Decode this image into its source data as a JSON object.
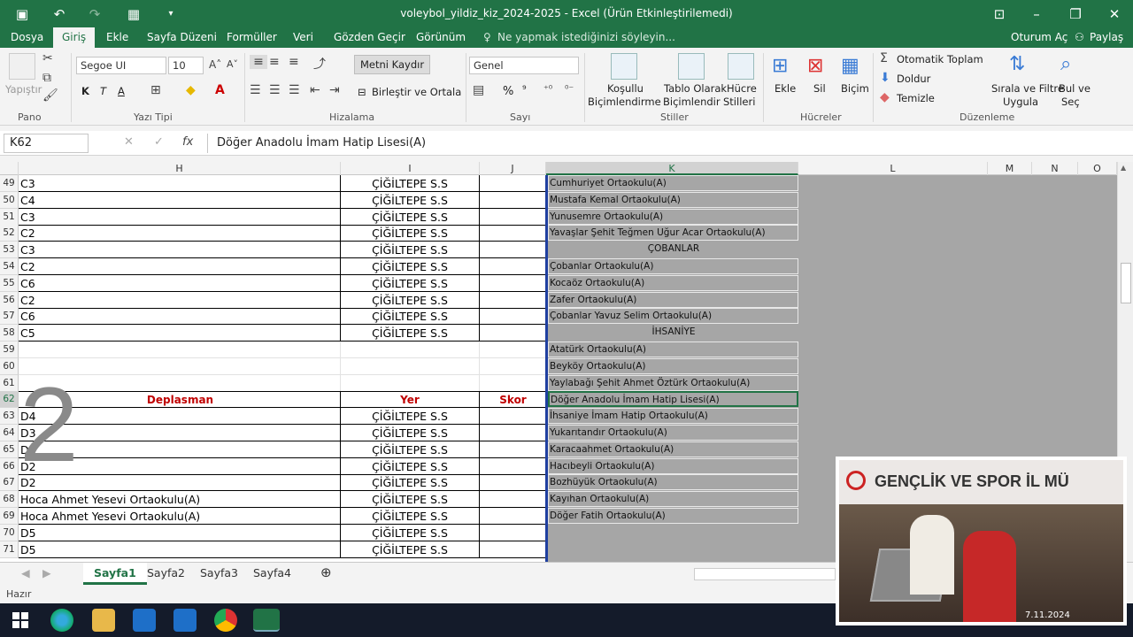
{
  "window": {
    "title": "voleybol_yildiz_kiz_2024-2025 - Excel (Ürün Etkinleştirilemedi)"
  },
  "tabs": [
    "Dosya",
    "Giriş",
    "Ekle",
    "Sayfa Düzeni",
    "Formüller",
    "Veri",
    "Gözden Geçir",
    "Görünüm"
  ],
  "tell_me": "Ne yapmak istediğinizi söyleyin...",
  "account": {
    "signin": "Oturum Aç",
    "share": "Paylaş"
  },
  "ribbon": {
    "clipboard": {
      "paste": "Yapıştır",
      "label": "Pano"
    },
    "font": {
      "name": "Segoe UI",
      "size": "10",
      "bold": "K",
      "italic": "T",
      "underline": "A",
      "label": "Yazı Tipi"
    },
    "alignment": {
      "wrap": "Metni Kaydır",
      "merge": "Birleştir ve Ortala",
      "label": "Hizalama"
    },
    "number": {
      "format": "Genel",
      "percent": "%",
      "comma": "⁹",
      "label": "Sayı"
    },
    "styles": {
      "conditional1": "Koşullu",
      "conditional2": "Biçimlendirme",
      "table1": "Tablo Olarak",
      "table2": "Biçimlendir",
      "cell1": "Hücre",
      "cell2": "Stilleri",
      "label": "Stiller"
    },
    "cells": {
      "insert": "Ekle",
      "delete": "Sil",
      "format": "Biçim",
      "label": "Hücreler"
    },
    "editing": {
      "autosum": "Otomatik Toplam",
      "fill": "Doldur",
      "clear": "Temizle",
      "sort1": "Sırala ve Filtre",
      "sort2": "Uygula",
      "find1": "Bul ve",
      "find2": "Seç",
      "label": "Düzenleme"
    }
  },
  "formula_bar": {
    "name_box": "K62",
    "fx": "fx",
    "content": "Döğer Anadolu İmam Hatip Lisesi(A)"
  },
  "columns": [
    "H",
    "I",
    "J",
    "K",
    "L",
    "M",
    "N",
    "O"
  ],
  "rows": [
    {
      "num": "49",
      "h": "C3",
      "i": "ÇİĞİLTEPE S.S",
      "j": ""
    },
    {
      "num": "50",
      "h": "C4",
      "i": "ÇİĞİLTEPE S.S",
      "j": ""
    },
    {
      "num": "51",
      "h": "C3",
      "i": "ÇİĞİLTEPE S.S",
      "j": ""
    },
    {
      "num": "52",
      "h": "C2",
      "i": "ÇİĞİLTEPE S.S",
      "j": ""
    },
    {
      "num": "53",
      "h": "C3",
      "i": "ÇİĞİLTEPE S.S",
      "j": ""
    },
    {
      "num": "54",
      "h": "C2",
      "i": "ÇİĞİLTEPE S.S",
      "j": ""
    },
    {
      "num": "55",
      "h": "C6",
      "i": "ÇİĞİLTEPE S.S",
      "j": ""
    },
    {
      "num": "56",
      "h": "C2",
      "i": "ÇİĞİLTEPE S.S",
      "j": ""
    },
    {
      "num": "57",
      "h": "C6",
      "i": "ÇİĞİLTEPE S.S",
      "j": ""
    },
    {
      "num": "58",
      "h": "C5",
      "i": "ÇİĞİLTEPE S.S",
      "j": ""
    },
    {
      "num": "59",
      "h": "",
      "i": "",
      "j": ""
    },
    {
      "num": "60",
      "h": "",
      "i": "",
      "j": ""
    },
    {
      "num": "61",
      "h": "",
      "i": "",
      "j": ""
    },
    {
      "num": "62",
      "h": "Deplasman",
      "i": "Yer",
      "j": "Skor"
    },
    {
      "num": "63",
      "h": "D4",
      "i": "ÇİĞİLTEPE S.S",
      "j": ""
    },
    {
      "num": "64",
      "h": "D3",
      "i": "ÇİĞİLTEPE S.S",
      "j": ""
    },
    {
      "num": "65",
      "h": "D3",
      "i": "ÇİĞİLTEPE S.S",
      "j": ""
    },
    {
      "num": "66",
      "h": "D2",
      "i": "ÇİĞİLTEPE S.S",
      "j": ""
    },
    {
      "num": "67",
      "h": "D2",
      "i": "ÇİĞİLTEPE S.S",
      "j": ""
    },
    {
      "num": "68",
      "h": "Hoca Ahmet Yesevi Ortaokulu(A)",
      "i": "ÇİĞİLTEPE S.S",
      "j": ""
    },
    {
      "num": "69",
      "h": "Hoca Ahmet Yesevi Ortaokulu(A)",
      "i": "ÇİĞİLTEPE S.S",
      "j": ""
    },
    {
      "num": "70",
      "h": "D5",
      "i": "ÇİĞİLTEPE S.S",
      "j": ""
    },
    {
      "num": "71",
      "h": "D5",
      "i": "ÇİĞİLTEPE S.S",
      "j": ""
    }
  ],
  "k_list": [
    "Cumhuriyet Ortaokulu(A)",
    "Mustafa Kemal Ortaokulu(A)",
    "Yunusemre Ortaokulu(A)",
    "Yavaşlar Şehit Teğmen Uğur Acar Ortaokulu(A)",
    "ÇOBANLAR",
    "Çobanlar Ortaokulu(A)",
    "Kocaöz Ortaokulu(A)",
    "Zafer Ortaokulu(A)",
    "Çobanlar Yavuz Selim Ortaokulu(A)",
    "İHSANİYE",
    "Atatürk Ortaokulu(A)",
    "Beyköy Ortaokulu(A)",
    "Yaylabağı Şehit Ahmet Öztürk Ortaokulu(A)",
    "Döğer Anadolu İmam Hatip Lisesi(A)",
    "İhsaniye İmam Hatip Ortaokulu(A)",
    "Yukarıtandır Ortaokulu(A)",
    "Karacaahmet Ortaokulu(A)",
    "Hacıbeyli Ortaokulu(A)",
    "Bozhüyük Ortaokulu(A)",
    "Kayıhan Ortaokulu(A)",
    "Döğer Fatih Ortaokulu(A)"
  ],
  "overlay_number": "2",
  "sheets": [
    "Sayfa1",
    "Sayfa2",
    "Sayfa3",
    "Sayfa4"
  ],
  "status": "Hazır",
  "webcam": {
    "banner": "GENÇLİK VE SPOR İL MÜ",
    "date": "7.11.2024"
  },
  "colors": {
    "excel_green": "#217346",
    "header_red": "#c00000",
    "selection_blue": "#1f3fa0"
  }
}
